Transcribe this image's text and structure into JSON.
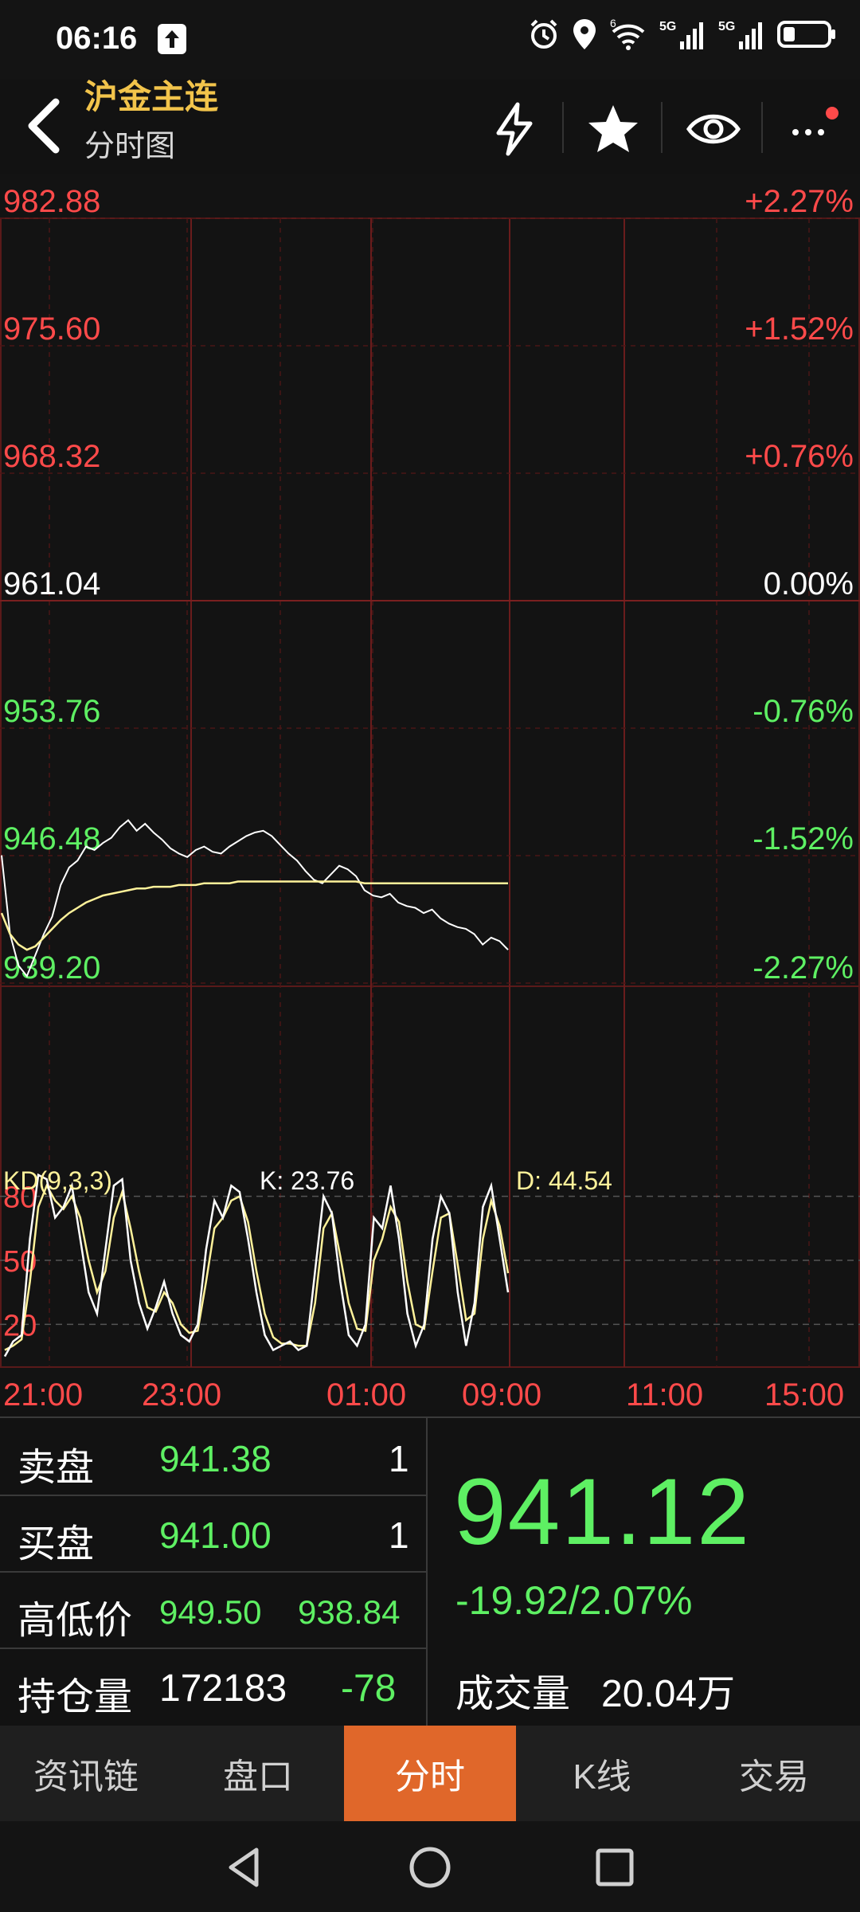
{
  "status_bar": {
    "time": "06:16",
    "network_1": "5G",
    "network_2": "5G",
    "wifi_badge": "6"
  },
  "header": {
    "title": "沪金主连",
    "subtitle": "分时图"
  },
  "chart_data": {
    "type": "line",
    "price_axis": {
      "ticks": [
        "982.88",
        "975.60",
        "968.32",
        "961.04",
        "953.76",
        "946.48",
        "939.20"
      ],
      "values": [
        982.88,
        975.6,
        968.32,
        961.04,
        953.76,
        946.48,
        939.2
      ],
      "pct_ticks": [
        "+2.27%",
        "+1.52%",
        "+0.76%",
        "0.00%",
        "-0.76%",
        "-1.52%",
        "-2.27%"
      ],
      "ylim": [
        939.2,
        982.88
      ],
      "reference": 961.04
    },
    "time_axis": [
      "21:00",
      "23:00",
      "01:00",
      "09:00",
      "11:00",
      "15:00"
    ],
    "series": [
      {
        "color": "#ffffff",
        "values": [
          946.5,
          942,
          940.2,
          939.6,
          940.8,
          942,
          943,
          944.8,
          945.8,
          946.2,
          947,
          946.8,
          947.2,
          947.5,
          948.1,
          948.5,
          947.9,
          948.3,
          947.8,
          947.4,
          946.9,
          946.6,
          946.4,
          946.8,
          947.0,
          946.7,
          946.6,
          947.0,
          947.3,
          947.6,
          947.8,
          947.9,
          947.6,
          947.1,
          946.6,
          946.2,
          945.6,
          945.1,
          944.9,
          945.4,
          945.9,
          945.7,
          945.3,
          944.5,
          944.2,
          944.1,
          944.3,
          943.8,
          943.6,
          943.5,
          943.2,
          943.4,
          942.9,
          942.6,
          942.4,
          942.3,
          942.0,
          941.4,
          941.8,
          941.6,
          941.1
        ]
      },
      {
        "color": "#fff29a",
        "values": [
          943.2,
          942,
          941.4,
          941.1,
          941.3,
          941.8,
          942.3,
          942.8,
          943.2,
          943.5,
          943.8,
          944.0,
          944.2,
          944.3,
          944.4,
          944.5,
          944.6,
          944.6,
          944.7,
          944.7,
          944.7,
          944.8,
          944.8,
          944.8,
          944.9,
          944.9,
          944.9,
          944.9,
          945.0,
          945.0,
          945.0,
          945.0,
          945.0,
          945.0,
          945.0,
          945.0,
          945.0,
          945.0,
          945.0,
          945.0,
          945.0,
          945.0,
          945.0,
          944.9,
          944.9,
          944.9,
          944.9,
          944.9,
          944.9,
          944.9,
          944.9,
          944.9,
          944.9,
          944.9,
          944.9,
          944.9,
          944.9,
          944.9,
          944.9,
          944.9,
          944.9
        ]
      }
    ],
    "indicator": {
      "name": "KD(9,3,3)",
      "k_label": "K: 23.76",
      "d_label": "D: 44.54",
      "levels": [
        80,
        50,
        20
      ],
      "ylim": [
        0,
        100
      ],
      "k_values": [
        5,
        12,
        15,
        60,
        90,
        88,
        70,
        75,
        85,
        60,
        35,
        25,
        55,
        85,
        88,
        50,
        30,
        18,
        28,
        40,
        25,
        15,
        12,
        20,
        55,
        78,
        70,
        85,
        82,
        60,
        35,
        15,
        8,
        10,
        12,
        8,
        10,
        45,
        80,
        72,
        40,
        15,
        10,
        20,
        70,
        65,
        85,
        60,
        25,
        10,
        20,
        60,
        80,
        72,
        35,
        10,
        30,
        75,
        85,
        60,
        35
      ],
      "d_values": [
        8,
        10,
        13,
        40,
        75,
        85,
        78,
        74,
        80,
        70,
        50,
        35,
        45,
        70,
        82,
        65,
        45,
        28,
        26,
        35,
        30,
        20,
        16,
        17,
        40,
        65,
        70,
        78,
        80,
        68,
        45,
        25,
        14,
        11,
        11,
        10,
        10,
        30,
        65,
        72,
        52,
        30,
        18,
        17,
        50,
        60,
        75,
        68,
        40,
        20,
        18,
        45,
        70,
        72,
        48,
        22,
        25,
        60,
        78,
        66,
        44
      ]
    }
  },
  "quote": {
    "ask_label": "卖盘",
    "ask_price": "941.38",
    "ask_qty": "1",
    "bid_label": "买盘",
    "bid_price": "941.00",
    "bid_qty": "1",
    "hl_label": "高低价",
    "high": "949.50",
    "low": "938.84",
    "oi_label": "持仓量",
    "oi_value": "172183",
    "oi_change": "-78",
    "last_price": "941.12",
    "change": "-19.92/2.07%",
    "volume_label": "成交量",
    "volume_value": "20.04万"
  },
  "tabs": [
    {
      "label": "资讯链"
    },
    {
      "label": "盘口"
    },
    {
      "label": "分时",
      "active": true
    },
    {
      "label": "K线"
    },
    {
      "label": "交易"
    }
  ],
  "colors": {
    "up": "#ff4a4a",
    "down": "#5ef063",
    "accent": "#e0672a",
    "title": "#f2c44b",
    "avg_line": "#fff29a"
  }
}
